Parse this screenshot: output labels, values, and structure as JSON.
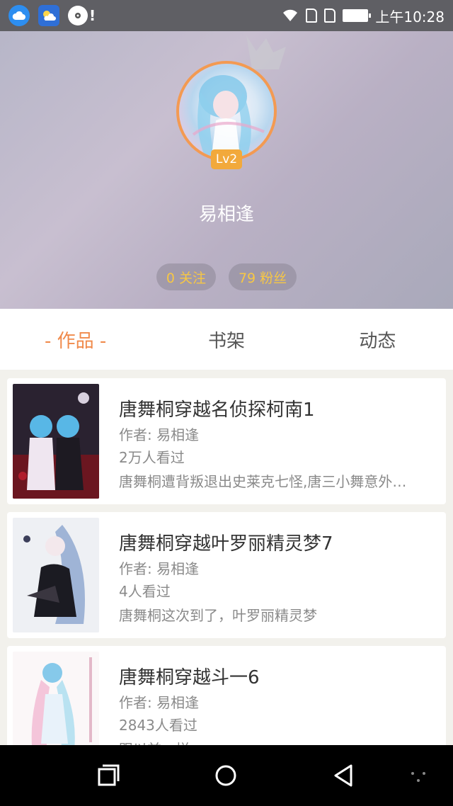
{
  "status_bar": {
    "time": "上午10:28",
    "left_icons": [
      "cloud-app-icon",
      "weather-app-icon",
      "music-disc-icon",
      "alert-icon"
    ],
    "right_icons": [
      "wifi-icon",
      "sim1-icon",
      "sim2-icon",
      "battery-icon"
    ],
    "alert_mark": "!"
  },
  "profile": {
    "username": "易相逢",
    "level": "Lv2",
    "following": "0 关注",
    "followers": "79 粉丝"
  },
  "tabs": [
    {
      "label": "- 作品 -",
      "active": true
    },
    {
      "label": "书架",
      "active": false
    },
    {
      "label": "动态",
      "active": false
    }
  ],
  "works": [
    {
      "title": "唐舞桐穿越名侦探柯南1",
      "author": "作者: 易相逢",
      "views": "2万人看过",
      "desc": "唐舞桐遭背叛退出史莱克七怪,唐三小舞意外…"
    },
    {
      "title": "唐舞桐穿越叶罗丽精灵梦7",
      "author": "作者: 易相逢",
      "views": "4人看过",
      "desc": "唐舞桐这次到了，叶罗丽精灵梦"
    },
    {
      "title": "唐舞桐穿越斗一6",
      "author": "作者: 易相逢",
      "views": "2843人看过",
      "desc": "跟以前一样"
    }
  ],
  "colors": {
    "accent": "#f08a4b",
    "badge": "#f2a93b",
    "stat_text": "#f7c744"
  },
  "nav_bar": [
    "recent-apps-icon",
    "home-icon",
    "back-icon",
    "menu-dots-icon"
  ]
}
